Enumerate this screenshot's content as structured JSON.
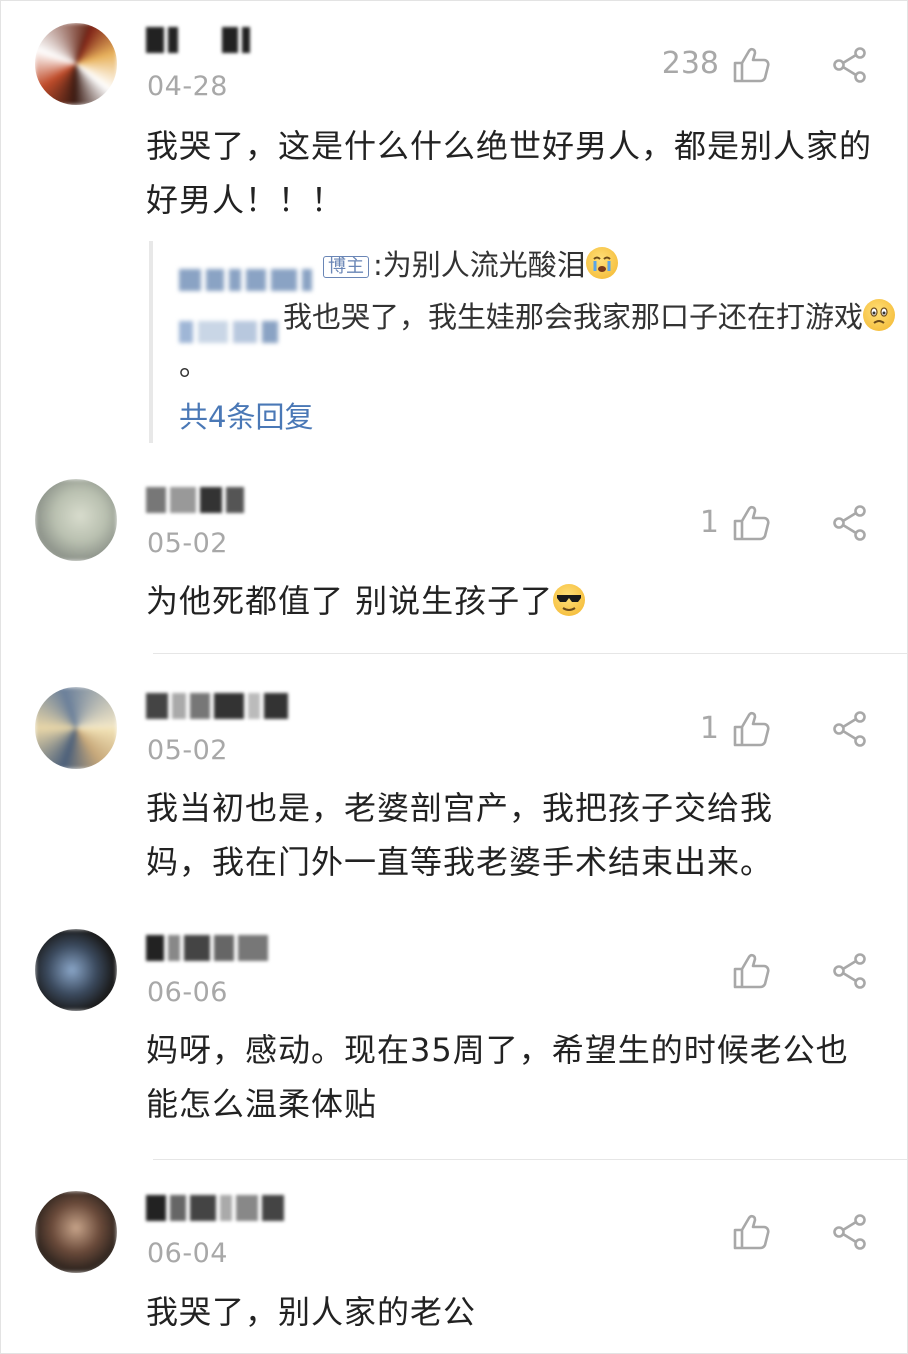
{
  "comments": [
    {
      "date": "04-28",
      "likes": "238",
      "text": "我哭了，这是什么什么绝世好男人，都是别人家的好男人！！！",
      "replies": {
        "badge": "博主",
        "line1": ":为别人流光酸泪",
        "line2": "我也哭了，我生娃那会我家那口子还在打游戏",
        "line2_end": "。",
        "more": "共4条回复"
      }
    },
    {
      "date": "05-02",
      "likes": "1",
      "text": "为他死都值了 别说生孩子了"
    },
    {
      "date": "05-02",
      "likes": "1",
      "text": "我当初也是，老婆剖宫产，我把孩子交给我妈，我在门外一直等我老婆手术结束出来。"
    },
    {
      "date": "06-06",
      "likes": "",
      "text": "妈呀，感动。现在35周了，希望生的时候老公也能怎么温柔体贴"
    },
    {
      "date": "06-04",
      "likes": "",
      "text": "我哭了，别人家的老公"
    }
  ],
  "icons": {
    "like": "thumbs-up-outline-icon",
    "share": "share-nodes-icon"
  },
  "colors": {
    "text": "#222222",
    "meta": "#a8a8a8",
    "link": "#4a78b6"
  }
}
